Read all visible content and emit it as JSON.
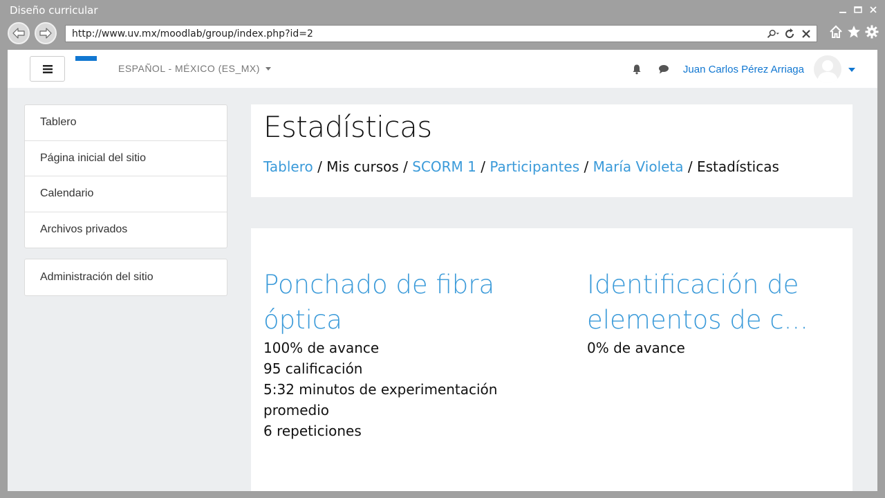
{
  "window": {
    "title": "Diseño curricular"
  },
  "browser": {
    "url": "http://www.uv.mx/moodlab/group/index.php?id=2"
  },
  "header": {
    "language": "ESPAÑOL - MÉXICO (ES_MX)",
    "user_name": "Juan Carlos Pérez Arriaga"
  },
  "sidebar": {
    "items": [
      {
        "label": "Tablero"
      },
      {
        "label": "Página inicial del sitio"
      },
      {
        "label": "Calendario"
      },
      {
        "label": "Archivos privados"
      }
    ],
    "admin": {
      "label": "Administración del sitio"
    }
  },
  "page": {
    "title": "Estadísticas",
    "breadcrumb": {
      "tablero": "Tablero",
      "mis_cursos": "Mis cursos",
      "scorm": "SCORM 1",
      "participantes": "Participantes",
      "maria": "María Violeta",
      "current": "Estadísticas",
      "sep": "/"
    }
  },
  "stats": [
    {
      "title": "Ponchado de fibra óptica",
      "lines": [
        "100% de avance",
        "95 calificación",
        "5:32 minutos de experimentación promedio",
        "6 repeticiones"
      ]
    },
    {
      "title": "Identificación de elementos de c...",
      "lines": [
        "0% de avance"
      ]
    }
  ],
  "colors": {
    "accent": "#1177d1",
    "link": "#3a9ad9",
    "page_bg": "#eceef0",
    "chrome": "#a0a0a0"
  }
}
